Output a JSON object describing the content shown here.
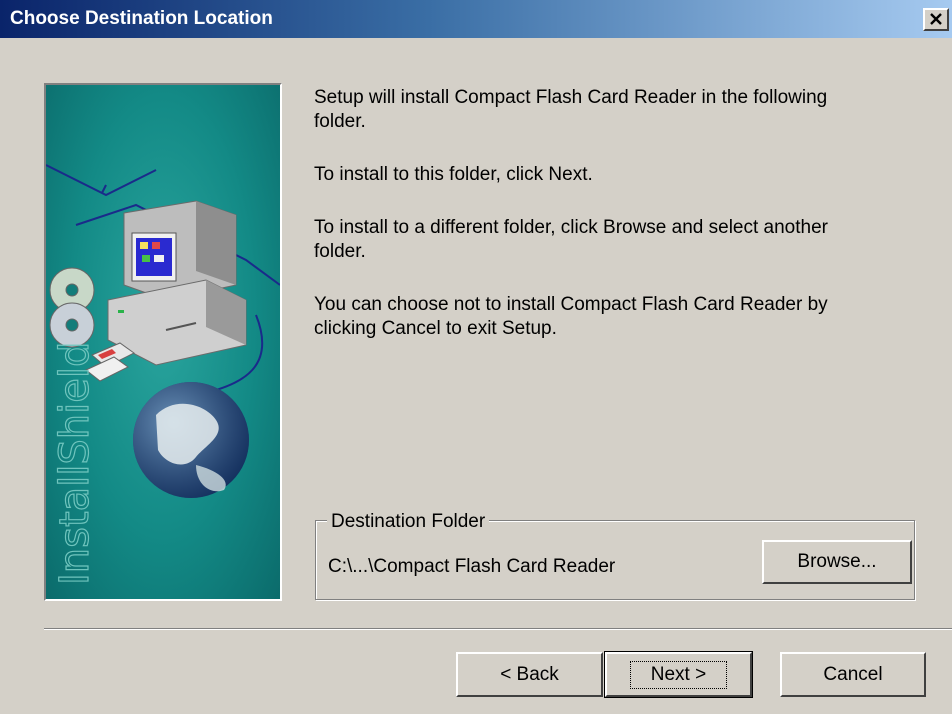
{
  "window": {
    "title": "Choose Destination Location"
  },
  "side_panel": {
    "brand": "InstallShield"
  },
  "messages": {
    "line1a": "Setup will install Compact Flash Card Reader in the following",
    "line1b": "folder.",
    "line2": "To install to this folder, click Next.",
    "line3a": "To install to a different folder, click Browse and select another",
    "line3b": "folder.",
    "line4a": "You can choose not to install Compact Flash Card Reader by",
    "line4b": "clicking Cancel to exit Setup."
  },
  "destination": {
    "legend": "Destination Folder",
    "path": "C:\\...\\Compact Flash Card Reader",
    "browse_label": "Browse..."
  },
  "buttons": {
    "back": "< Back",
    "next": "Next >",
    "cancel": "Cancel"
  }
}
